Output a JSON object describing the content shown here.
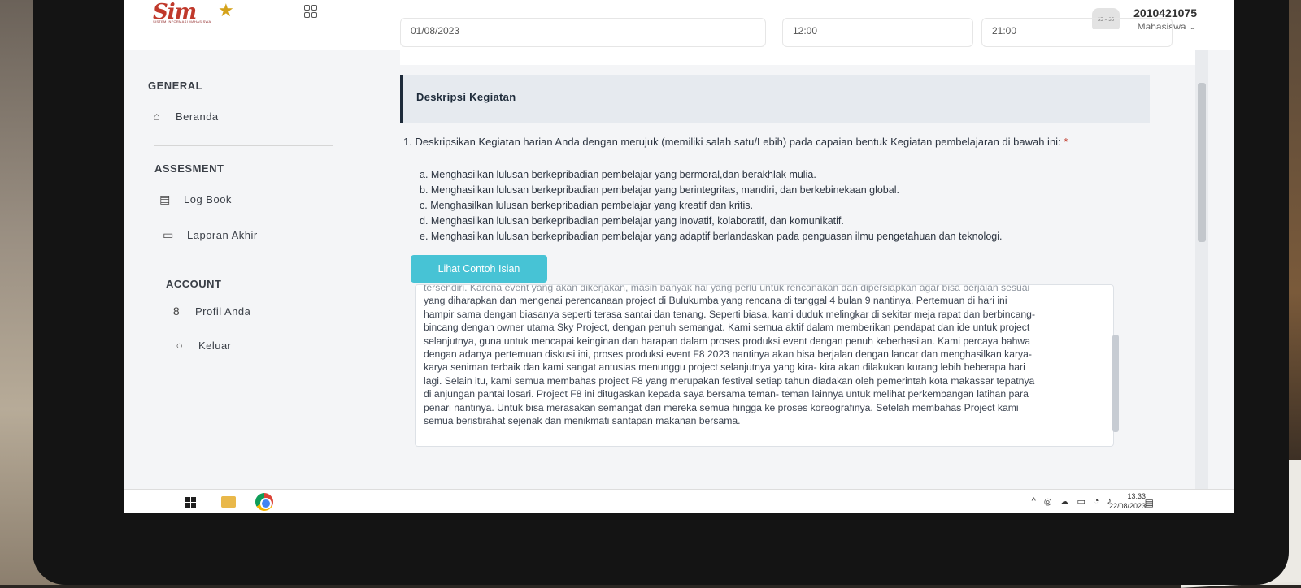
{
  "app": {
    "logo_text": "Sim",
    "logo_tagline": "SISTEM INFORMASI MAHASISWA"
  },
  "header": {
    "user_id": "2010421075",
    "user_role": "Mahasiswa ⌄",
    "avatar_text": "35 × 35"
  },
  "datebar": {
    "date": "01/08/2023",
    "start": "12:00",
    "end": "21:00"
  },
  "sidebar": {
    "general_title": "GENERAL",
    "beranda": "Beranda",
    "assesment_title": "ASSESMENT",
    "logbook": "Log Book",
    "laporan": "Laporan Akhir",
    "account_title": "ACCOUNT",
    "profil": "Profil Anda",
    "keluar": "Keluar"
  },
  "main": {
    "section_title": "Deskripsi Kegiatan",
    "question": "1. Deskripsikan Kegiatan harian Anda dengan merujuk (memiliki salah satu/Lebih) pada capaian bentuk Kegiatan pembelajaran di bawah ini:",
    "required_mark": "*",
    "options": [
      "a. Menghasilkan lulusan berkepribadian pembelajar yang bermoral,dan berakhlak mulia.",
      "b. Menghasilkan lulusan berkepribadian pembelajar yang berintegritas, mandiri, dan berkebinekaan global.",
      "c. Menghasilkan lulusan berkepribadian pembelajar yang kreatif dan kritis.",
      "d. Menghasilkan lulusan berkepribadian pembelajar yang inovatif, kolaboratif, dan komunikatif.",
      "e. Menghasilkan lulusan berkepribadian pembelajar yang adaptif berlandaskan pada penguasan ilmu pengetahuan dan teknologi."
    ],
    "example_button": "Lihat Contoh Isian",
    "textarea_lines": [
      "tersendiri. Karena event yang akan dikerjakan, masih banyak hal yang perlu untuk rencanakan dan dipersiapkan agar bisa berjalan sesuai",
      "yang diharapkan dan mengenai perencanaan project di Bulukumba yang rencana di tanggal 4 bulan 9 nantinya. Pertemuan di hari ini",
      "hampir sama dengan biasanya seperti terasa santai dan tenang. Seperti biasa, kami duduk melingkar di sekitar meja rapat dan berbincang-",
      "bincang dengan owner utama Sky Project, dengan penuh semangat. Kami semua aktif dalam memberikan pendapat dan ide untuk project",
      "selanjutnya, guna untuk mencapai keinginan dan harapan dalam proses produksi event dengan penuh keberhasilan. Kami percaya bahwa",
      "dengan adanya pertemuan diskusi ini, proses produksi event F8 2023 nantinya akan bisa berjalan dengan lancar dan menghasilkan karya-",
      "karya seniman terbaik dan kami sangat antusias menunggu project selanjutnya yang kira- kira akan dilakukan kurang lebih beberapa hari",
      "lagi. Selain itu, kami semua membahas project F8 yang merupakan festival setiap tahun diadakan oleh pemerintah kota makassar tepatnya",
      "di anjungan pantai losari. Project F8 ini ditugaskan kepada saya bersama teman- teman lainnya untuk melihat perkembangan latihan para",
      "penari nantinya. Untuk bisa merasakan semangat dari mereka semua hingga ke proses koreografinya. Setelah membahas Project kami",
      "semua beristirahat sejenak dan menikmati santapan makanan bersama."
    ]
  },
  "taskbar": {
    "time": "13:33",
    "date": "22/08/2023"
  },
  "colors": {
    "accent": "#47c3d5",
    "header_bar": "#1e2b3a",
    "logo_red": "#c0392b"
  }
}
